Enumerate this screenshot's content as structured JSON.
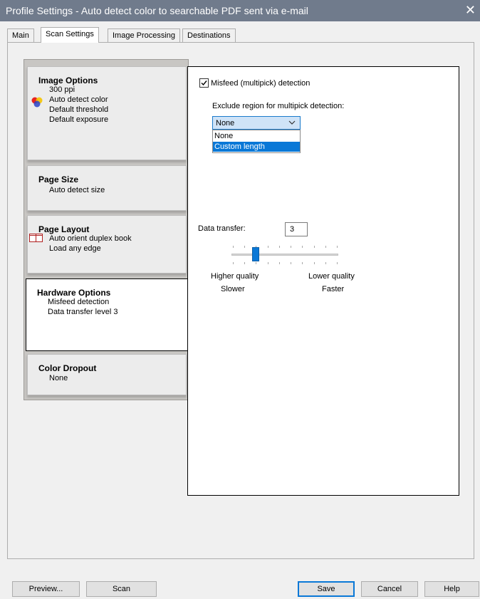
{
  "window": {
    "title": "Profile Settings - Auto detect color to searchable PDF sent via e-mail",
    "close_glyph": "✕"
  },
  "tabs": [
    {
      "label": "Main"
    },
    {
      "label": "Scan Settings",
      "active": true
    },
    {
      "label": "Image Processing"
    },
    {
      "label": "Destinations"
    }
  ],
  "cards": {
    "image_options": {
      "title": "Image Options",
      "lines": [
        "300 ppi",
        "Auto detect color",
        "Default threshold",
        "Default exposure"
      ],
      "icon": "color-circles-icon"
    },
    "page_size": {
      "title": "Page Size",
      "lines": [
        "Auto detect size"
      ]
    },
    "page_layout": {
      "title": "Page Layout",
      "lines": [
        "Auto orient duplex book",
        "Load any edge"
      ],
      "icon": "book-layout-icon"
    },
    "hardware_options": {
      "title": "Hardware Options",
      "lines": [
        "Misfeed detection",
        "Data transfer level 3"
      ],
      "active": true
    },
    "color_dropout": {
      "title": "Color Dropout",
      "lines": [
        "None"
      ]
    }
  },
  "hardware": {
    "misfeed": {
      "label": "Misfeed (multipick) detection",
      "checked": true
    },
    "exclude_label": "Exclude region for multipick detection:",
    "exclude_select": {
      "value": "None",
      "options": [
        "None",
        "Custom length"
      ],
      "highlighted": "Custom length"
    },
    "data_transfer": {
      "label": "Data transfer:",
      "value": "3",
      "slider_min": 1,
      "slider_max": 10,
      "left_caption_1": "Higher quality",
      "left_caption_2": "Slower",
      "right_caption_1": "Lower quality",
      "right_caption_2": "Faster"
    }
  },
  "buttons": {
    "preview": "Preview...",
    "scan": "Scan",
    "save": "Save",
    "cancel": "Cancel",
    "help": "Help"
  },
  "colors": {
    "titlebar": "#707b8c",
    "accent": "#0a78d7",
    "dropdown_bg": "#cfe3f7"
  }
}
